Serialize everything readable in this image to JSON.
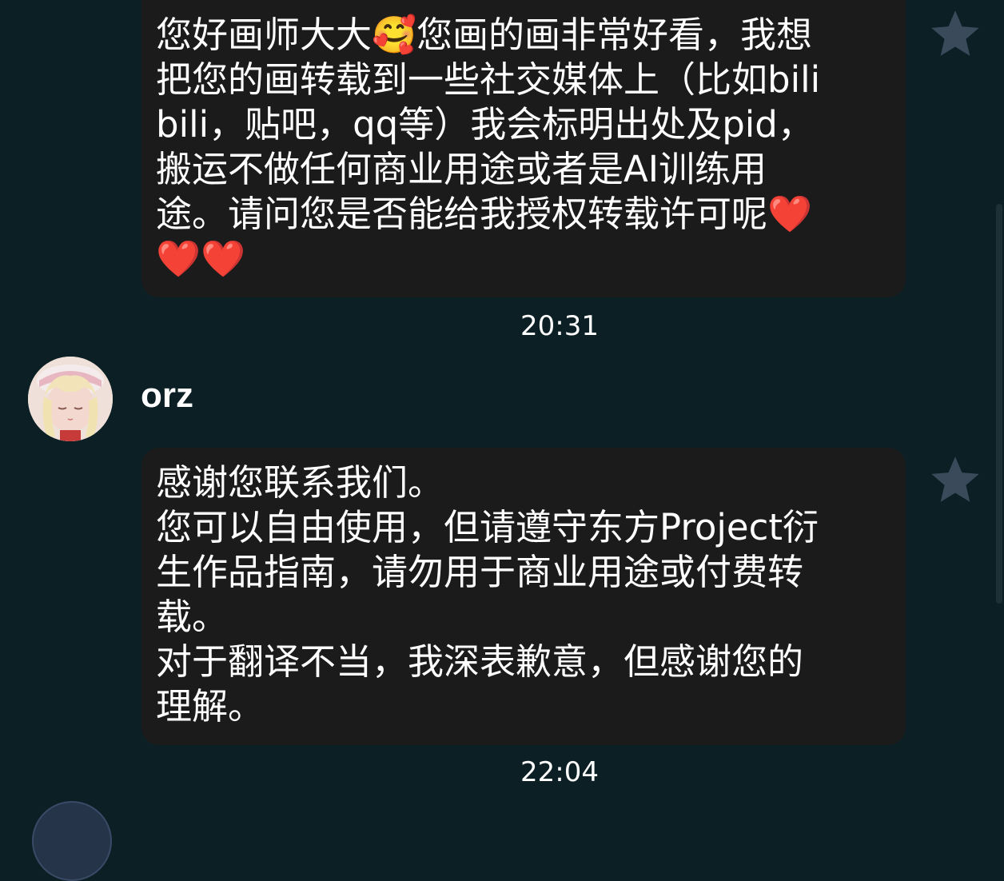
{
  "messages": [
    {
      "text": "您好画师大大🥰您画的画非常好看，我想\n把您的画转载到一些社交媒体上（比如bili\nbili，贴吧，qq等）我会标明出处及pid，\n搬运不做任何商业用途或者是AI训练用\n途。请问您是否能给我授权转载许可呢❤️\n❤️❤️",
      "time": "20:31",
      "star_icon": "star-icon"
    },
    {
      "sender": "orz",
      "text": "感谢您联系我们。\n您可以自由使用，但请遵守东方Project衍\n生作品指南，请勿用于商业用途或付费转\n载。\n对于翻译不当，我深表歉意，但感谢您的\n理解。",
      "time": "22:04",
      "star_icon": "star-icon"
    }
  ],
  "colors": {
    "background": "#0b1f25",
    "bubble": "#1b1b1b",
    "star": "#3a4a5a",
    "text": "#ffffff"
  }
}
